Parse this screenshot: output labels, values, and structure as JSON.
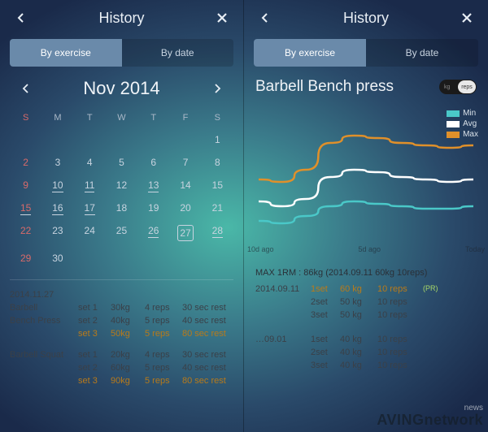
{
  "left": {
    "header": {
      "title": "History"
    },
    "tabs": [
      "By exercise",
      "By date"
    ],
    "month_title": "Nov 2014",
    "weekdays": [
      "S",
      "M",
      "T",
      "W",
      "T",
      "F",
      "S"
    ],
    "calendar_rows": [
      [
        {
          "d": ""
        },
        {
          "d": ""
        },
        {
          "d": ""
        },
        {
          "d": ""
        },
        {
          "d": ""
        },
        {
          "d": ""
        },
        {
          "d": "1"
        }
      ],
      [
        {
          "d": "2"
        },
        {
          "d": "3"
        },
        {
          "d": "4"
        },
        {
          "d": "5"
        },
        {
          "d": "6"
        },
        {
          "d": "7"
        },
        {
          "d": "8"
        }
      ],
      [
        {
          "d": "9"
        },
        {
          "d": "10",
          "u": true
        },
        {
          "d": "11",
          "u": true
        },
        {
          "d": "12"
        },
        {
          "d": "13",
          "u": true
        },
        {
          "d": "14"
        },
        {
          "d": "15"
        }
      ],
      [
        {
          "d": "15",
          "u": true
        },
        {
          "d": "16",
          "u": true
        },
        {
          "d": "17",
          "u": true
        },
        {
          "d": "18"
        },
        {
          "d": "19"
        },
        {
          "d": "20"
        },
        {
          "d": "21"
        }
      ],
      [
        {
          "d": "22"
        },
        {
          "d": "23"
        },
        {
          "d": "24"
        },
        {
          "d": "25"
        },
        {
          "d": "26",
          "u": true
        },
        {
          "d": "27",
          "today": true
        },
        {
          "d": "28",
          "u": true
        }
      ],
      [
        {
          "d": "29"
        },
        {
          "d": "30"
        },
        {
          "d": ""
        },
        {
          "d": ""
        },
        {
          "d": ""
        },
        {
          "d": ""
        },
        {
          "d": ""
        }
      ]
    ],
    "log": {
      "date": "2014.11.27",
      "exercises": [
        {
          "name": [
            "Barbell",
            "Bench Press"
          ],
          "sets": [
            {
              "set": "set 1",
              "wt": "30kg",
              "reps": "4 reps",
              "rest": "30 sec rest"
            },
            {
              "set": "set 2",
              "wt": "40kg",
              "reps": "5 reps",
              "rest": "40 sec rest"
            },
            {
              "set": "set 3",
              "wt": "50kg",
              "reps": "5 reps",
              "rest": "80 sec rest",
              "hl": true
            }
          ]
        },
        {
          "name": [
            "Barbell Squat",
            ""
          ],
          "sets": [
            {
              "set": "set 1",
              "wt": "20kg",
              "reps": "4 reps",
              "rest": "30 sec rest"
            },
            {
              "set": "set 2",
              "wt": "60kg",
              "reps": "5 reps",
              "rest": "40 sec rest"
            },
            {
              "set": "set 3",
              "wt": "90kg",
              "reps": "5 reps",
              "rest": "80 sec rest",
              "hl": true
            }
          ]
        }
      ]
    }
  },
  "right": {
    "header": {
      "title": "History"
    },
    "tabs": [
      "By exercise",
      "By date"
    ],
    "exercise_title": "Barbell Bench press",
    "toggle": {
      "off_label": "kg",
      "on_label": "reps"
    },
    "max1rm_line": "MAX 1RM : 86kg (2014.09.11 60kg 10reps)",
    "sessions": [
      {
        "date": "2014.09.11",
        "sets": [
          {
            "set": "1set",
            "wt": "60 kg",
            "reps": "10 reps",
            "hl": true,
            "pr": "(PR)"
          },
          {
            "set": "2set",
            "wt": "50 kg",
            "reps": "10 reps"
          },
          {
            "set": "3set",
            "wt": "50 kg",
            "reps": "10 reps"
          }
        ]
      },
      {
        "date": "…09.01",
        "sets": [
          {
            "set": "1set",
            "wt": "40 kg",
            "reps": "10 reps"
          },
          {
            "set": "2set",
            "wt": "40 kg",
            "reps": "10 reps"
          },
          {
            "set": "3set",
            "wt": "40 kg",
            "reps": "10 reps"
          }
        ]
      }
    ]
  },
  "chart_data": {
    "type": "line",
    "x_labels": [
      "10d ago",
      "5d ago",
      "Today"
    ],
    "series": [
      {
        "name": "Min",
        "color": "#4ac8c8",
        "values": [
          38,
          37,
          40,
          44,
          46,
          45,
          44,
          43,
          43,
          44
        ]
      },
      {
        "name": "Avg",
        "color": "#ffffff",
        "values": [
          46,
          44,
          47,
          56,
          59,
          58,
          56,
          55,
          54,
          55
        ]
      },
      {
        "name": "Max",
        "color": "#e0902a",
        "values": [
          55,
          54,
          59,
          70,
          73,
          72,
          70,
          69,
          68,
          69
        ]
      }
    ],
    "ylim": [
      30,
      80
    ]
  },
  "watermark": {
    "line1": "news",
    "line2": "AVINGnetwork"
  }
}
